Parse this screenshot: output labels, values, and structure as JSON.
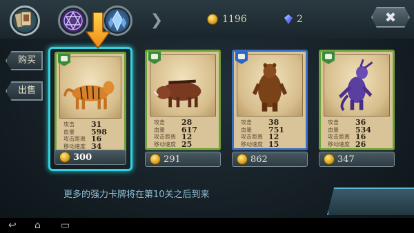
{
  "resources": {
    "gold": "1196",
    "gems": "2"
  },
  "side_tabs": {
    "buy": "购买",
    "sell": "出售"
  },
  "close_label": "✖",
  "cards": [
    {
      "creature": "tiger",
      "frame": "green",
      "hp": "31",
      "atk": "598",
      "def": "16",
      "spd": "34",
      "price": "300",
      "selected": true
    },
    {
      "creature": "boar",
      "frame": "green",
      "hp": "28",
      "atk": "617",
      "def": "12",
      "spd": "25",
      "price": "291",
      "selected": false
    },
    {
      "creature": "bear",
      "frame": "blue",
      "hp": "38",
      "atk": "751",
      "def": "12",
      "spd": "15",
      "price": "862",
      "selected": false
    },
    {
      "creature": "purple-beast",
      "frame": "green",
      "hp": "36",
      "atk": "534",
      "def": "16",
      "spd": "26",
      "price": "347",
      "selected": false
    }
  ],
  "stat_labels": {
    "l1": "攻击",
    "l2": "血量",
    "l3": "攻击距离",
    "l4": "移动速度"
  },
  "message": "更多的强力卡牌将在第10关之后到来",
  "nav": {
    "back": "↩",
    "home": "⌂",
    "recent": "▭"
  },
  "colors": {
    "selected_border": "#2fd4e0",
    "green_frame": "#6fa238",
    "blue_frame": "#3a6fc0",
    "message": "#8ec0d8"
  }
}
